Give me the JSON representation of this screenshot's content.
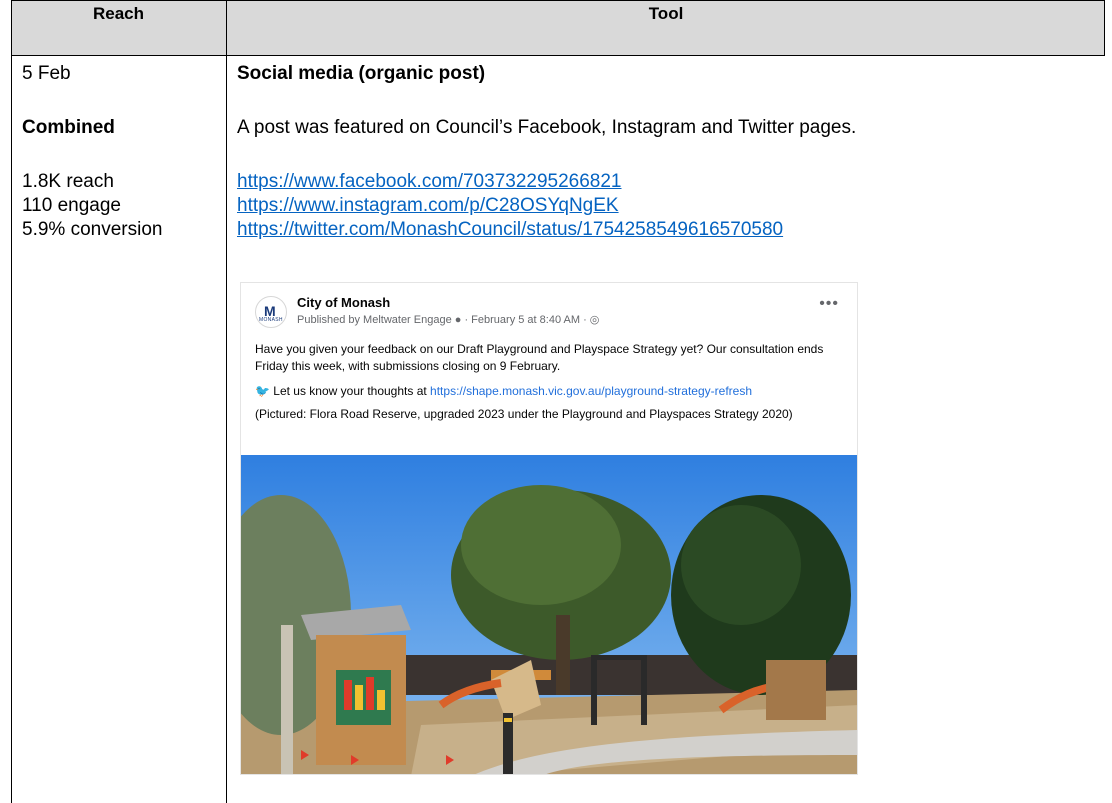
{
  "header": {
    "reach": "Reach",
    "tool": "Tool"
  },
  "reach_col": {
    "date": "5 Feb",
    "combined_label": "Combined",
    "stats": [
      "1.8K reach",
      "110 engage",
      "5.9% conversion"
    ]
  },
  "tool_col": {
    "title": "Social media (organic post)",
    "description": "A post was featured on Council’s Facebook, Instagram and Twitter pages.",
    "links": [
      "https://www.facebook.com/703732295266821",
      "https://www.instagram.com/p/C28OSYqNgEK",
      "https://twitter.com/MonashCouncil/status/1754258549616570580"
    ]
  },
  "post": {
    "logo_mark": "M",
    "logo_sub": "MONASH",
    "page_name": "City of Monash",
    "meta": "Published by Meltwater Engage ● · February 5 at 8:40 AM · ◎",
    "menu_icon": "ellipsis-icon",
    "paragraph1": "Have you given your feedback on our Draft Playground and Playspace Strategy yet? Our consultation ends Friday this week, with submissions closing on 9 February.",
    "paragraph2_prefix": "Let us know your thoughts at ",
    "paragraph2_link": "https://shape.monash.vic.gov.au/playground-strategy-refresh",
    "paragraph3": "(Pictured: Flora Road Reserve, upgraded 2023 under the Playground and Playspaces Strategy 2020)",
    "photo_icon": "playground-photo"
  },
  "colors": {
    "header_bg": "#d9d9d9",
    "link": "#0563c1",
    "fb_link": "#216fdb"
  }
}
